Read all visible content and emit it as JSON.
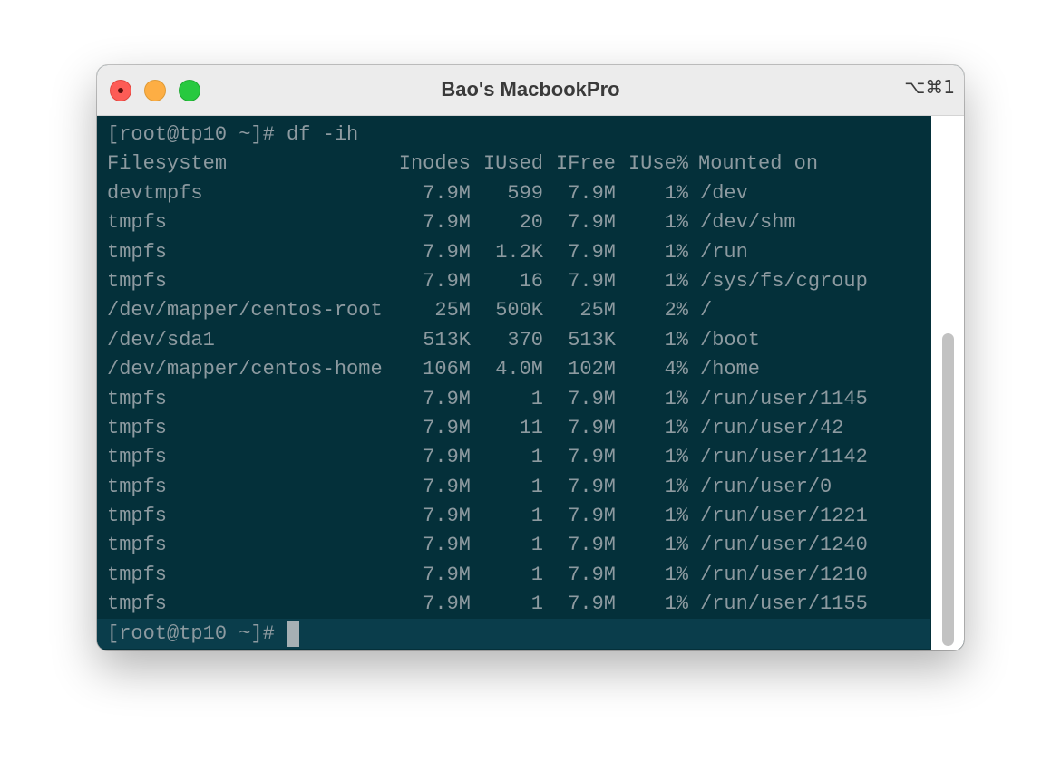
{
  "window": {
    "title": "Bao's MacbookPro",
    "shortcut": "⌥⌘1"
  },
  "terminal": {
    "command_line": "[root@tp10 ~]# df -ih",
    "header": {
      "filesystem": "Filesystem",
      "inodes": "Inodes",
      "iused": "IUsed",
      "ifree": "IFree",
      "iuse_pct": "IUse%",
      "mounted_on": "Mounted on"
    },
    "rows": [
      {
        "filesystem": "devtmpfs",
        "inodes": "7.9M",
        "iused": "599",
        "ifree": "7.9M",
        "iuse_pct": "1%",
        "mounted_on": "/dev"
      },
      {
        "filesystem": "tmpfs",
        "inodes": "7.9M",
        "iused": "20",
        "ifree": "7.9M",
        "iuse_pct": "1%",
        "mounted_on": "/dev/shm"
      },
      {
        "filesystem": "tmpfs",
        "inodes": "7.9M",
        "iused": "1.2K",
        "ifree": "7.9M",
        "iuse_pct": "1%",
        "mounted_on": "/run"
      },
      {
        "filesystem": "tmpfs",
        "inodes": "7.9M",
        "iused": "16",
        "ifree": "7.9M",
        "iuse_pct": "1%",
        "mounted_on": "/sys/fs/cgroup"
      },
      {
        "filesystem": "/dev/mapper/centos-root",
        "inodes": "25M",
        "iused": "500K",
        "ifree": "25M",
        "iuse_pct": "2%",
        "mounted_on": "/"
      },
      {
        "filesystem": "/dev/sda1",
        "inodes": "513K",
        "iused": "370",
        "ifree": "513K",
        "iuse_pct": "1%",
        "mounted_on": "/boot"
      },
      {
        "filesystem": "/dev/mapper/centos-home",
        "inodes": "106M",
        "iused": "4.0M",
        "ifree": "102M",
        "iuse_pct": "4%",
        "mounted_on": "/home"
      },
      {
        "filesystem": "tmpfs",
        "inodes": "7.9M",
        "iused": "1",
        "ifree": "7.9M",
        "iuse_pct": "1%",
        "mounted_on": "/run/user/1145"
      },
      {
        "filesystem": "tmpfs",
        "inodes": "7.9M",
        "iused": "11",
        "ifree": "7.9M",
        "iuse_pct": "1%",
        "mounted_on": "/run/user/42"
      },
      {
        "filesystem": "tmpfs",
        "inodes": "7.9M",
        "iused": "1",
        "ifree": "7.9M",
        "iuse_pct": "1%",
        "mounted_on": "/run/user/1142"
      },
      {
        "filesystem": "tmpfs",
        "inodes": "7.9M",
        "iused": "1",
        "ifree": "7.9M",
        "iuse_pct": "1%",
        "mounted_on": "/run/user/0"
      },
      {
        "filesystem": "tmpfs",
        "inodes": "7.9M",
        "iused": "1",
        "ifree": "7.9M",
        "iuse_pct": "1%",
        "mounted_on": "/run/user/1221"
      },
      {
        "filesystem": "tmpfs",
        "inodes": "7.9M",
        "iused": "1",
        "ifree": "7.9M",
        "iuse_pct": "1%",
        "mounted_on": "/run/user/1240"
      },
      {
        "filesystem": "tmpfs",
        "inodes": "7.9M",
        "iused": "1",
        "ifree": "7.9M",
        "iuse_pct": "1%",
        "mounted_on": "/run/user/1210"
      },
      {
        "filesystem": "tmpfs",
        "inodes": "7.9M",
        "iused": "1",
        "ifree": "7.9M",
        "iuse_pct": "1%",
        "mounted_on": "/run/user/1155"
      }
    ],
    "prompt": "[root@tp10 ~]#"
  },
  "colors": {
    "terminal_bg": "#04303a",
    "terminal_fg": "#8d9aa0",
    "current_line_bg": "#0a3d4b",
    "titlebar_bg": "#ececec"
  },
  "icons": {
    "close": "close-icon",
    "minimize": "minimize-icon",
    "maximize": "maximize-icon"
  }
}
